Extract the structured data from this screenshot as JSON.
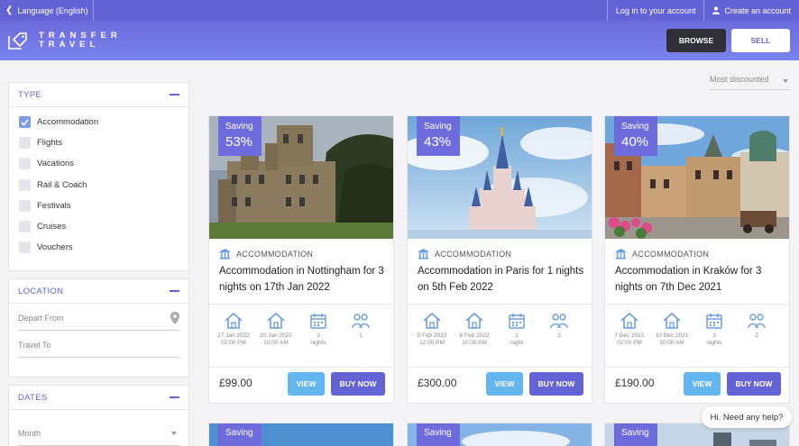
{
  "topbar": {
    "language": "Language (English)",
    "login": "Log in to your account",
    "create": "Create an account"
  },
  "header": {
    "logo_line1": "TRANSFER",
    "logo_line2": "TRAVEL",
    "browse": "BROWSE",
    "sell": "SELL"
  },
  "sidebar": {
    "type_title": "TYPE",
    "types": [
      {
        "label": "Accommodation",
        "checked": true
      },
      {
        "label": "Flights",
        "checked": false
      },
      {
        "label": "Vacations",
        "checked": false
      },
      {
        "label": "Rail & Coach",
        "checked": false
      },
      {
        "label": "Festivals",
        "checked": false
      },
      {
        "label": "Cruises",
        "checked": false
      },
      {
        "label": "Vouchers",
        "checked": false
      }
    ],
    "location_title": "LOCATION",
    "depart_placeholder": "Depart From",
    "travel_placeholder": "Travel To",
    "dates_title": "DATES",
    "month_placeholder": "Month"
  },
  "sort": {
    "selected": "Most discounted"
  },
  "cards": [
    {
      "saving_label": "Saving",
      "saving": "53%",
      "category": "ACCOMMODATION",
      "title": "Accommodation in Nottingham for 3 nights on 17th Jan 2022",
      "checkin_date": "17 Jan 2022",
      "checkin_time": "02:00 PM",
      "checkout_date": "20 Jan 2022",
      "checkout_time": "10:00 AM",
      "nights": "3",
      "nights_label": "nights",
      "guests": "1",
      "price": "£99.00",
      "view": "VIEW",
      "buy": "BUY NOW"
    },
    {
      "saving_label": "Saving",
      "saving": "43%",
      "category": "ACCOMMODATION",
      "title": "Accommodation in Paris for 1 nights on 5th Feb 2022",
      "checkin_date": "5 Feb 2022",
      "checkin_time": "12:00 PM",
      "checkout_date": "6 Feb 2022",
      "checkout_time": "10:00 AM",
      "nights": "1",
      "nights_label": "night",
      "guests": "3",
      "price": "£300.00",
      "view": "VIEW",
      "buy": "BUY NOW"
    },
    {
      "saving_label": "Saving",
      "saving": "40%",
      "category": "ACCOMMODATION",
      "title": "Accommodation in Kraków for 3 nights on 7th Dec 2021",
      "checkin_date": "7 Dec 2021",
      "checkin_time": "02:00 PM",
      "checkout_date": "10 Dec 2021",
      "checkout_time": "10:00 AM",
      "nights": "3",
      "nights_label": "nights",
      "guests": "2",
      "price": "£190.00",
      "view": "VIEW",
      "buy": "BUY NOW"
    }
  ],
  "more_cards": [
    {
      "saving_label": "Saving"
    },
    {
      "saving_label": "Saving"
    },
    {
      "saving_label": "Saving"
    }
  ],
  "chat": {
    "label": "Hi. Need any help?"
  },
  "colors": {
    "brand": "#6463d6",
    "view": "#63b6f0",
    "dark": "#2f3136"
  }
}
